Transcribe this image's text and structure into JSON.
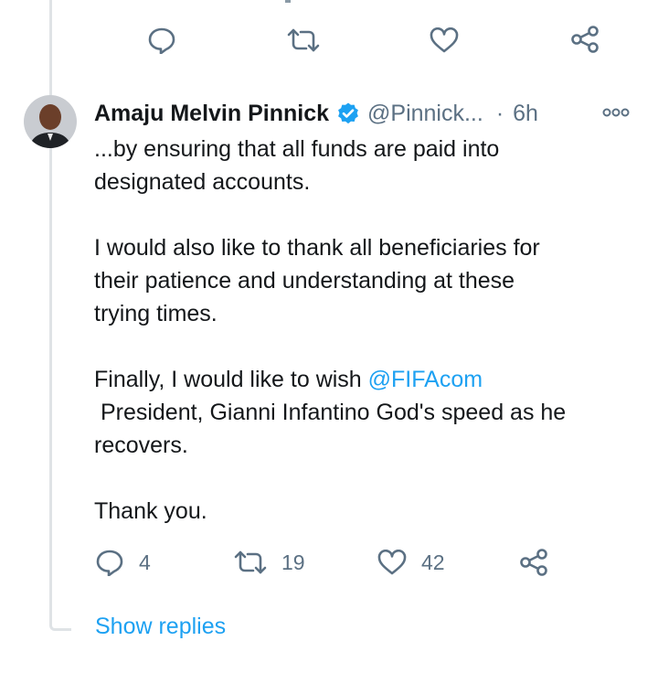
{
  "top_actions": {
    "reply_icon": "reply-icon",
    "retweet_icon": "retweet-icon",
    "like_icon": "heart-icon",
    "share_icon": "share-icon"
  },
  "tweet": {
    "author": {
      "display_name": "Amaju Melvin Pinnick",
      "verified": true,
      "handle": "@Pinnick...",
      "separator": "·",
      "time": "6h"
    },
    "text": {
      "p1_line1": "...by ensuring that all funds are paid into",
      "p1_line2": "designated accounts.",
      "p2_line1": "I would also like to thank all beneficiaries for",
      "p2_line2": "their patience and understanding at these",
      "p2_line3": "trying times.",
      "p3_line1_prefix": "Finally, I would like to wish ",
      "p3_mention": "@FIFAcom",
      "p3_line2": " President, Gianni Infantino God's speed as he",
      "p3_line3": "recovers.",
      "p4_line1": "Thank you."
    },
    "stats": {
      "replies": "4",
      "retweets": "19",
      "likes": "42"
    }
  },
  "show_replies": "Show replies",
  "colors": {
    "accent": "#1da1f2",
    "muted": "#5b7083",
    "text": "#14171a",
    "thread_line": "#dfe3e6"
  }
}
